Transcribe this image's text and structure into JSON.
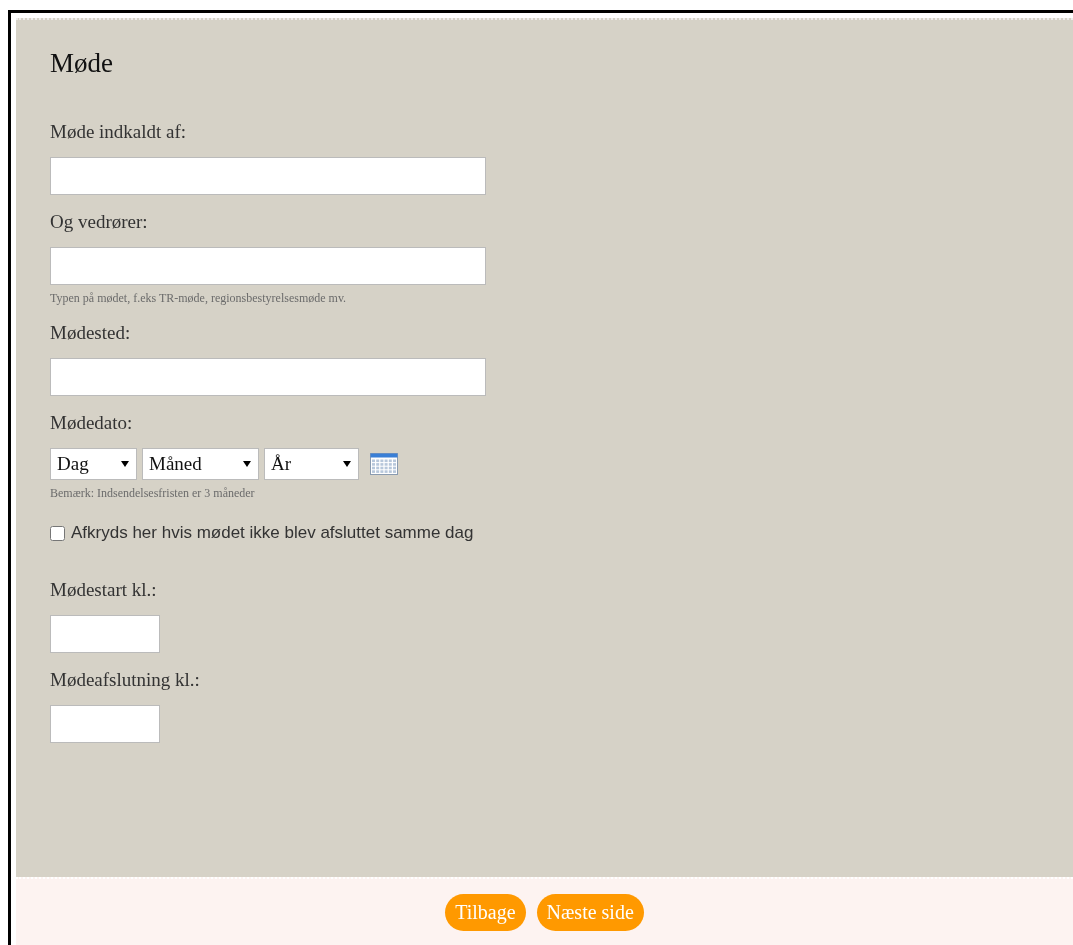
{
  "form": {
    "title": "Møde",
    "fields": [
      {
        "kind": "text",
        "label": "Møde indkaldt af:"
      },
      {
        "kind": "text",
        "label": "Og vedrører:",
        "hint": "Typen på mødet, f.eks TR-møde, regionsbestyrelsesmøde mv."
      },
      {
        "kind": "text",
        "label": "Mødested:"
      },
      {
        "kind": "date",
        "label": "Mødedato:",
        "selects": [
          "Dag",
          "Måned",
          "År"
        ],
        "hint": "Bemærk: Indsendelsesfristen er 3 måneder"
      },
      {
        "kind": "checkbox",
        "label": "Afkryds her hvis mødet ikke blev afsluttet samme dag",
        "checked": false
      },
      {
        "kind": "time",
        "label": "Mødestart kl.:"
      },
      {
        "kind": "time",
        "label": "Mødeafslutning kl.:"
      }
    ]
  },
  "buttons": [
    "Tilbage",
    "Næste side"
  ]
}
